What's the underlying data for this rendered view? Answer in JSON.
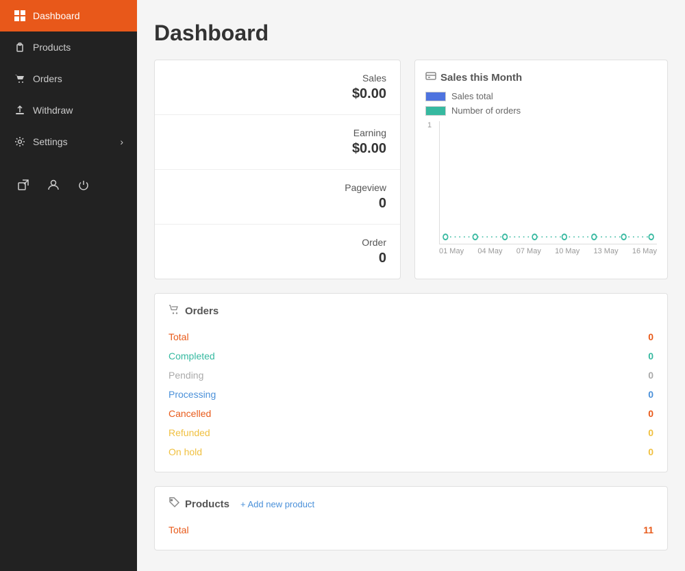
{
  "page": {
    "title": "Dashboard"
  },
  "sidebar": {
    "items": [
      {
        "label": "Dashboard",
        "active": true,
        "icon": "grid-icon"
      },
      {
        "label": "Products",
        "active": false,
        "icon": "briefcase-icon"
      },
      {
        "label": "Orders",
        "active": false,
        "icon": "cart-icon"
      },
      {
        "label": "Withdraw",
        "active": false,
        "icon": "upload-icon"
      },
      {
        "label": "Settings",
        "active": false,
        "icon": "gear-icon",
        "arrow": "›"
      }
    ],
    "bottom_icons": [
      {
        "icon": "external-link-icon",
        "symbol": "⬡"
      },
      {
        "icon": "user-icon",
        "symbol": "👤"
      },
      {
        "icon": "power-icon",
        "symbol": "⏻"
      }
    ]
  },
  "stats": {
    "items": [
      {
        "label": "Sales",
        "value": "$0.00"
      },
      {
        "label": "Earning",
        "value": "$0.00"
      },
      {
        "label": "Pageview",
        "value": "0"
      },
      {
        "label": "Order",
        "value": "0"
      }
    ]
  },
  "chart": {
    "title": "Sales this Month",
    "title_icon": "credit-card-icon",
    "legend": [
      {
        "label": "Sales total",
        "color": "blue"
      },
      {
        "label": "Number of orders",
        "color": "green"
      }
    ],
    "y_label": "1",
    "x_labels": [
      "01 May",
      "04 May",
      "07 May",
      "10 May",
      "13 May",
      "16 May"
    ]
  },
  "orders": {
    "title": "Orders",
    "title_icon": "cart-icon",
    "rows": [
      {
        "label": "Total",
        "value": "0",
        "class": "orange"
      },
      {
        "label": "Completed",
        "value": "0",
        "class": "green"
      },
      {
        "label": "Pending",
        "value": "0",
        "class": "pending"
      },
      {
        "label": "Processing",
        "value": "0",
        "class": "blue"
      },
      {
        "label": "Cancelled",
        "value": "0",
        "class": "orange"
      },
      {
        "label": "Refunded",
        "value": "0",
        "class": "yellow"
      },
      {
        "label": "On hold",
        "value": "0",
        "class": "yellow"
      }
    ]
  },
  "products": {
    "title": "Products",
    "title_icon": "tag-icon",
    "add_link_text": "+ Add new product",
    "rows": [
      {
        "label": "Total",
        "value": "11",
        "class": "orange"
      }
    ]
  }
}
